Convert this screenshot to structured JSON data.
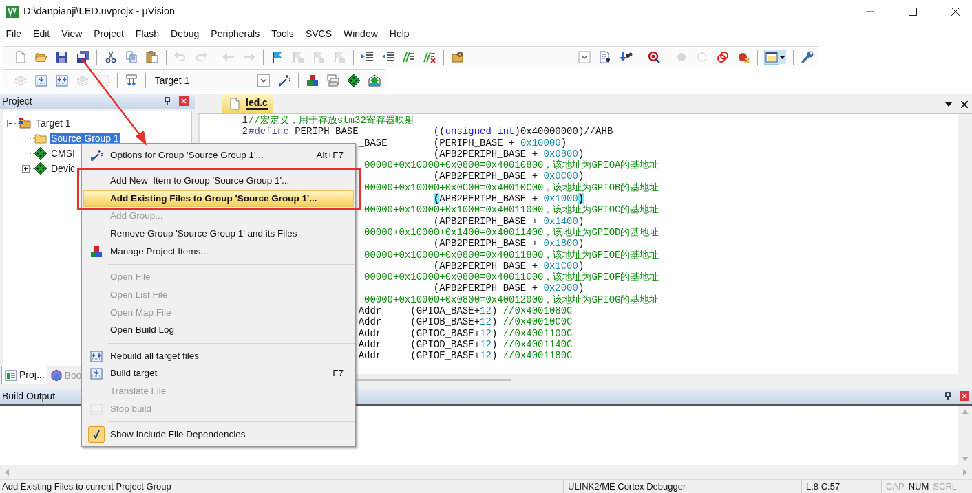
{
  "window": {
    "title": "D:\\danpianji\\LED.uvprojx - µVision"
  },
  "menu_bar": [
    "File",
    "Edit",
    "View",
    "Project",
    "Flash",
    "Debug",
    "Peripherals",
    "Tools",
    "SVCS",
    "Window",
    "Help"
  ],
  "toolbar_1": [
    {
      "disabled": false,
      "pressed": false
    },
    {
      "disabled": false,
      "pressed": false
    },
    {
      "disabled": false,
      "pressed": false
    },
    {
      "disabled": false,
      "pressed": false
    },
    {
      "disabled": false,
      "pressed": false
    },
    {
      "disabled": false,
      "pressed": false
    },
    {
      "disabled": false,
      "pressed": false
    },
    {
      "disabled": true,
      "pressed": false
    },
    {
      "disabled": true,
      "pressed": false
    },
    {
      "disabled": true,
      "pressed": false
    },
    {
      "disabled": true,
      "pressed": false
    },
    {
      "disabled": false,
      "pressed": false
    },
    {
      "disabled": true,
      "pressed": false
    },
    {
      "disabled": true,
      "pressed": false
    },
    {
      "disabled": true,
      "pressed": false
    },
    {
      "disabled": false,
      "pressed": false
    },
    {
      "disabled": false,
      "pressed": false
    },
    {
      "disabled": false,
      "pressed": false
    },
    {
      "disabled": false,
      "pressed": false
    },
    {
      "disabled": false,
      "pressed": false
    },
    {
      "disabled": false,
      "pressed": false
    },
    {
      "disabled": false,
      "pressed": false
    },
    {
      "disabled": false,
      "pressed": false
    },
    {
      "disabled": false,
      "pressed": false
    },
    {
      "disabled": true,
      "pressed": false
    },
    {
      "disabled": true,
      "pressed": false
    },
    {
      "disabled": false,
      "pressed": false
    },
    {
      "disabled": false,
      "pressed": false
    },
    {
      "disabled": false,
      "pressed": true
    },
    {
      "disabled": false,
      "pressed": false
    }
  ],
  "toolbar_2": {
    "buttons": [
      {
        "disabled": true
      },
      {
        "disabled": false
      },
      {
        "disabled": false
      },
      {
        "disabled": true
      },
      {
        "disabled": true
      },
      {
        "disabled": false
      },
      {
        "disabled": false
      },
      {
        "disabled": false
      },
      {
        "disabled": false
      },
      {
        "disabled": false
      },
      {
        "disabled": false
      }
    ],
    "target": "Target 1"
  },
  "project_panel": {
    "title": "Project",
    "tree": [
      {
        "label": "Target 1",
        "kind": "target",
        "expanded": true,
        "selected": false,
        "children": [
          {
            "label": "Source Group 1",
            "kind": "group",
            "selected": true
          },
          {
            "label": "CMSI",
            "kind": "component",
            "selected": false
          },
          {
            "label": "Devic",
            "kind": "component",
            "expanded": false,
            "selected": false
          }
        ]
      }
    ],
    "tabs": [
      {
        "label": "Proj...",
        "selected": true
      },
      {
        "label": "Boo",
        "selected": false
      }
    ]
  },
  "editor": {
    "tabs": [
      {
        "label": "led.c",
        "selected": true
      }
    ],
    "lines": [
      {
        "kind": "full",
        "number": "1",
        "segments": [
          {
            "kind": "comment",
            "text": "//宏定义，用于存放stm32寄存器映射"
          }
        ]
      },
      {
        "kind": "full",
        "number": "2",
        "segments": [
          {
            "kind": "directive",
            "text": "#define"
          },
          {
            "kind": "plain",
            "text": " PERIPH_BASE             (("
          },
          {
            "kind": "keyword",
            "text": "unsigned int"
          },
          {
            "kind": "plain",
            "text": ")0x40000000)//AHB"
          }
        ]
      },
      {
        "kind": "macro",
        "segments": [
          {
            "kind": "plain",
            "text": "_BASE        (PERIPH_BASE + "
          },
          {
            "kind": "number",
            "text": "0x10000"
          },
          {
            "kind": "plain",
            "text": ")"
          }
        ]
      },
      {
        "kind": "value",
        "segments": [
          {
            "kind": "plain",
            "text": "(APB2PERIPH_BASE + "
          },
          {
            "kind": "number",
            "text": "0x0800"
          },
          {
            "kind": "plain",
            "text": ")"
          }
        ]
      },
      {
        "kind": "comment",
        "segments": [
          {
            "kind": "comment",
            "text": "00000+0x10000+0x0800=0x40010800，该地址为GPIOA的基地址"
          }
        ]
      },
      {
        "kind": "value",
        "segments": [
          {
            "kind": "plain",
            "text": "(APB2PERIPH_BASE + "
          },
          {
            "kind": "number",
            "text": "0x0C00"
          },
          {
            "kind": "plain",
            "text": ")"
          }
        ]
      },
      {
        "kind": "comment",
        "segments": [
          {
            "kind": "comment",
            "text": "00000+0x10000+0x0C00=0x40010C00，该地址为GPIOB的基地址"
          }
        ]
      },
      {
        "kind": "value",
        "segments": [
          {
            "kind": "match",
            "text": "("
          },
          {
            "kind": "plain",
            "text": "APB2PERIPH_BASE + "
          },
          {
            "kind": "number",
            "text": "0x1000"
          },
          {
            "kind": "match",
            "text": ")"
          }
        ]
      },
      {
        "kind": "comment",
        "segments": [
          {
            "kind": "comment",
            "text": "00000+0x10000+0x1000=0x40011000，该地址为GPIOC的基地址"
          }
        ]
      },
      {
        "kind": "value",
        "segments": [
          {
            "kind": "plain",
            "text": "(APB2PERIPH_BASE + "
          },
          {
            "kind": "number",
            "text": "0x1400"
          },
          {
            "kind": "plain",
            "text": ")"
          }
        ]
      },
      {
        "kind": "comment",
        "segments": [
          {
            "kind": "comment",
            "text": "00000+0x10000+0x1400=0x40011400，该地址为GPIOD的基地址"
          }
        ]
      },
      {
        "kind": "value",
        "segments": [
          {
            "kind": "plain",
            "text": "(APB2PERIPH_BASE + "
          },
          {
            "kind": "number",
            "text": "0x1800"
          },
          {
            "kind": "plain",
            "text": ")"
          }
        ]
      },
      {
        "kind": "comment",
        "segments": [
          {
            "kind": "comment",
            "text": "00000+0x10000+0x0800=0x40011800，该地址为GPIOE的基地址"
          }
        ]
      },
      {
        "kind": "value",
        "segments": [
          {
            "kind": "plain",
            "text": "(APB2PERIPH_BASE + "
          },
          {
            "kind": "number",
            "text": "0x1C00"
          },
          {
            "kind": "plain",
            "text": ")"
          }
        ]
      },
      {
        "kind": "comment",
        "segments": [
          {
            "kind": "comment",
            "text": "00000+0x10000+0x0800=0x40011C00，该地址为GPIOF的基地址"
          }
        ]
      },
      {
        "kind": "value",
        "segments": [
          {
            "kind": "plain",
            "text": "(APB2PERIPH_BASE + "
          },
          {
            "kind": "number",
            "text": "0x2000"
          },
          {
            "kind": "plain",
            "text": ")"
          }
        ]
      },
      {
        "kind": "comment",
        "segments": [
          {
            "kind": "comment",
            "text": "00000+0x10000+0x0800=0x40012000，该地址为GPIOG的基地址"
          }
        ]
      },
      {
        "kind": "addr",
        "segments": [
          {
            "kind": "plain",
            "text": "Addr     (GPIOA_BASE+"
          },
          {
            "kind": "number",
            "text": "12"
          },
          {
            "kind": "plain",
            "text": ") "
          },
          {
            "kind": "comment",
            "text": "//0x4001080C"
          }
        ]
      },
      {
        "kind": "addr",
        "segments": [
          {
            "kind": "plain",
            "text": "Addr     (GPIOB_BASE+"
          },
          {
            "kind": "number",
            "text": "12"
          },
          {
            "kind": "plain",
            "text": ") "
          },
          {
            "kind": "comment",
            "text": "//0x40010C0C"
          }
        ]
      },
      {
        "kind": "addr",
        "segments": [
          {
            "kind": "plain",
            "text": "Addr     (GPIOC_BASE+"
          },
          {
            "kind": "number",
            "text": "12"
          },
          {
            "kind": "plain",
            "text": ") "
          },
          {
            "kind": "comment",
            "text": "//0x4001100C"
          }
        ]
      },
      {
        "kind": "addr",
        "segments": [
          {
            "kind": "plain",
            "text": "Addr     (GPIOD_BASE+"
          },
          {
            "kind": "number",
            "text": "12"
          },
          {
            "kind": "plain",
            "text": ") "
          },
          {
            "kind": "comment",
            "text": "//0x4001140C"
          }
        ]
      },
      {
        "kind": "addr",
        "segments": [
          {
            "kind": "plain",
            "text": "Addr     (GPIOE_BASE+"
          },
          {
            "kind": "number",
            "text": "12"
          },
          {
            "kind": "plain",
            "text": ") "
          },
          {
            "kind": "comment",
            "text": "//0x4001180C"
          }
        ]
      }
    ]
  },
  "build_output": {
    "title": "Build Output"
  },
  "context_menu": [
    {
      "kind": "item",
      "label": "Options for Group 'Source Group 1'...",
      "shortcut": "Alt+F7",
      "disabled": false,
      "selected": false,
      "checked": false
    },
    {
      "kind": "separator"
    },
    {
      "kind": "item",
      "label": "Add New  Item to Group 'Source Group 1'...",
      "disabled": false,
      "selected": false,
      "checked": false
    },
    {
      "kind": "item",
      "label": "Add Existing Files to Group 'Source Group 1'...",
      "disabled": false,
      "selected": true,
      "checked": false
    },
    {
      "kind": "item",
      "label": "Add Group...",
      "disabled": true,
      "selected": false,
      "checked": false
    },
    {
      "kind": "item",
      "label": "Remove Group 'Source Group 1' and its Files",
      "disabled": false,
      "selected": false,
      "checked": false
    },
    {
      "kind": "item",
      "label": "Manage Project Items...",
      "disabled": false,
      "selected": false,
      "checked": false
    },
    {
      "kind": "separator"
    },
    {
      "kind": "item",
      "label": "Open File",
      "disabled": true,
      "selected": false,
      "checked": false
    },
    {
      "kind": "item",
      "label": "Open List File",
      "disabled": true,
      "selected": false,
      "checked": false
    },
    {
      "kind": "item",
      "label": "Open Map File",
      "disabled": true,
      "selected": false,
      "checked": false
    },
    {
      "kind": "item",
      "label": "Open Build Log",
      "disabled": false,
      "selected": false,
      "checked": false
    },
    {
      "kind": "separator"
    },
    {
      "kind": "item",
      "label": "Rebuild all target files",
      "disabled": false,
      "selected": false,
      "checked": false
    },
    {
      "kind": "item",
      "label": "Build target",
      "shortcut": "F7",
      "disabled": false,
      "selected": false,
      "checked": false
    },
    {
      "kind": "item",
      "label": "Translate File",
      "disabled": true,
      "selected": false,
      "checked": false
    },
    {
      "kind": "item",
      "label": "Stop build",
      "disabled": true,
      "selected": false,
      "checked": false
    },
    {
      "kind": "separator"
    },
    {
      "kind": "item",
      "label": "Show Include File Dependencies",
      "disabled": false,
      "selected": false,
      "checked": true
    }
  ],
  "status_bar": {
    "message": "Add Existing Files to current Project Group",
    "debugger": "ULINK2/ME Cortex Debugger",
    "position": "L:8 C:57",
    "indicators": [
      {
        "label": "CAP",
        "on": false
      },
      {
        "label": "NUM",
        "on": true
      },
      {
        "label": "SCRL",
        "on": false
      }
    ]
  }
}
